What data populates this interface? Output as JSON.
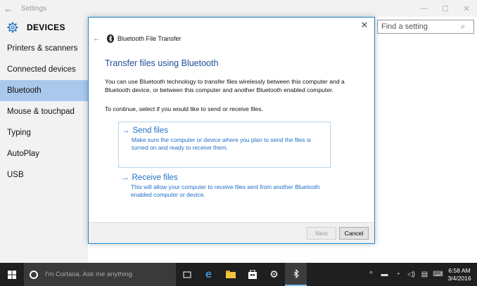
{
  "window": {
    "title": "Settings",
    "back_glyph": "←",
    "minimize_glyph": "—",
    "maximize_glyph": "☐",
    "close_glyph": "✕"
  },
  "sidebar": {
    "header": "DEVICES",
    "items": [
      {
        "label": "Printers & scanners"
      },
      {
        "label": "Connected devices"
      },
      {
        "label": "Bluetooth"
      },
      {
        "label": "Mouse & touchpad"
      },
      {
        "label": "Typing"
      },
      {
        "label": "AutoPlay"
      },
      {
        "label": "USB"
      }
    ],
    "active_index": 2
  },
  "search": {
    "placeholder": "Find a setting"
  },
  "dialog": {
    "app_title": "Bluetooth File Transfer",
    "heading": "Transfer files using Bluetooth",
    "intro": "You can use Bluetooth technology to transfer files wirelessly between this computer and a Bluetooth device, or between this computer and another Bluetooth enabled computer.",
    "prompt": "To continue, select if you would like to send or receive files.",
    "options": [
      {
        "title": "Send files",
        "description": "Make sure the computer or device where you plan to send the files is turned on and ready to receive them."
      },
      {
        "title": "Receive files",
        "description": "This will allow your computer to receive files sent from another Bluetooth enabled computer or device."
      }
    ],
    "next_label": "Next",
    "cancel_label": "Cancel"
  },
  "taskbar": {
    "cortana_text": "I'm Cortana. Ask me anything.",
    "time": "6:58 AM",
    "date": "3/4/2016"
  },
  "colors": {
    "accent": "#1f6fc5",
    "selected_nav": "#a9c8ec",
    "dialog_border": "#1a8ad4",
    "taskbar": "#1f1f1f"
  }
}
